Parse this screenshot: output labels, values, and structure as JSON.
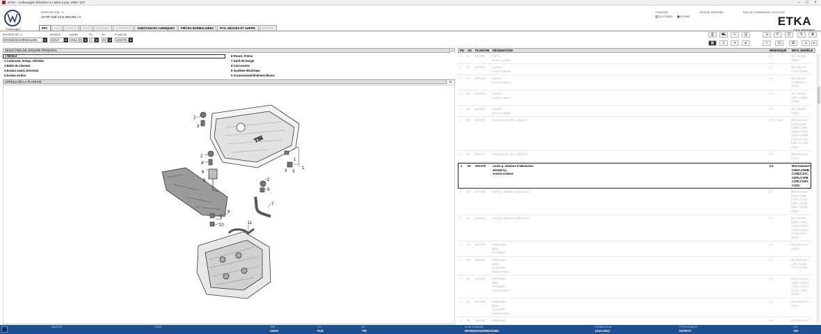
{
  "window": {
    "title": "ETKA - Volkswagen Révision 8.1 Mise à jour 1380 / 227"
  },
  "header": {
    "brand_label": "Volkswagen",
    "proposition_label": "PROPOSITION / 3",
    "proposition_value": "ACTIF  Golf A3 E 000 001 >>",
    "mode_label": "ÉTENDUE",
    "mode_options": [
      "ALLOWED",
      "ETHNIC"
    ],
    "link1": "BON DE MATÉRIEL",
    "link2": "BON DE COMMANDE COLLECTIF",
    "etka_logo": "ETKA",
    "etka_sub": "Parts Information"
  },
  "tabs": [
    {
      "label": "EPC",
      "state": "active"
    },
    {
      "label": "ACC",
      "state": "disabled"
    },
    {
      "label": "TOOLS",
      "state": "disabled"
    },
    {
      "label": "ROW",
      "state": "disabled"
    },
    {
      "label": "WEOLDIE",
      "state": "disabled"
    },
    {
      "label": "AUTOPART",
      "state": "disabled"
    },
    {
      "label": "SUBSTANCES CHIMIQUES",
      "state": "normal"
    },
    {
      "label": "PIÈCES NORMALISÉES",
      "state": "normal"
    },
    {
      "label": "PCS. NEUVES ET SUPPR.",
      "state": "normal"
    },
    {
      "label": "REPORT",
      "state": "disabled"
    }
  ],
  "search": {
    "recherche_label": "RECHERCHE / II",
    "recherche_value": "WVWZZZAUZEW211496",
    "modele_label": "MODÈLE",
    "modele_value": "GOLF",
    "annee_label": "ANNÉE",
    "annee_value": "2014 (E)",
    "pg_label": "PG",
    "pg_value": "1",
    "sg_label": "SG",
    "sg_value": "03",
    "planche_label": "PLANCHE",
    "planche_value": "103-075"
  },
  "group_panel": {
    "title": "SÉLECTION DE GROUPE PRINCIPAL",
    "items": [
      {
        "label": "1   Moteur",
        "selected": true
      },
      {
        "label": "2   Carburant, échap. refroidis."
      },
      {
        "label": "3   Boîte de vitesses"
      },
      {
        "label": "4   Essieu avant, Direction"
      },
      {
        "label": "5   Essieu arrière"
      },
      {
        "label": "6   Roues, Freins"
      },
      {
        "label": "7   Outil de levage"
      },
      {
        "label": "8   Carrosserie"
      },
      {
        "label": "9   Système électrique"
      },
      {
        "label": "0   Accessoires/Infodivert./divers"
      }
    ]
  },
  "apercu": {
    "title": "APERÇU DE LA PLANCHE",
    "callouts": [
      "1",
      "1",
      "2",
      "2",
      "2",
      "3",
      "3",
      "3",
      "3",
      "4",
      "5",
      "6",
      "7",
      "8",
      "9",
      "10",
      "11"
    ]
  },
  "parts_table": {
    "headers": [
      "PG",
      "SG",
      "PLANCHE",
      "DÉSIGNATION",
      "REMARQUE",
      "INFO. MODÈLE"
    ],
    "rows": [
      {
        "pg": "1",
        "sg": "03",
        "planche": "103-055",
        "designation": "Cache\ncouvre-culasse",
        "remarque": "1,0",
        "info": "Mot. diesel+\nDBHA",
        "selected": false
      },
      {
        "pg": "1",
        "sg": "03",
        "planche": "103-060",
        "designation": "Culasse\ncouvre-culasse",
        "remarque": "2,0",
        "info": "Mot. diesel+\nCHHA,CRBC",
        "selected": false
      },
      {
        "pg": "1",
        "sg": "03",
        "planche": "103-062",
        "designation": "Culasse\ncouvre-culasse",
        "remarque": "2,0",
        "info": "Mot. diesel+\nCYKB,DEJA,\nDEJB",
        "selected": false
      },
      {
        "pg": "1",
        "sg": "03",
        "planche": "103-065",
        "designation": "Culasse\ncouvre-culasse",
        "remarque": "2,0",
        "info": "Mot. diesel+\nCRLB,CRMC,\nCRMA",
        "selected": false
      },
      {
        "pg": "1",
        "sg": "03",
        "planche": "103-067",
        "designation": "Culasse\ncouvre-culasse",
        "remarque": "2,0",
        "info": "Mot. diesel+\nCRQA",
        "selected": false
      },
      {
        "pg": "1",
        "sg": "03",
        "planche": "103-070",
        "designation": "Aération pour bloc-cylindres",
        "remarque": "1,0-1,4 litre",
        "info": "Mot.essence+\nCJZA,CJZB,\nCMBA,CHPA,\nCPWA,CPTA,\nCXSA,CPWB,\nCYVA,CYVB,\nCZEA,CPWB,\nCZCA",
        "selected": false
      },
      {
        "pg": "1",
        "sg": "03",
        "planche": "103-072",
        "designation": "Aération pour bloc-cylindres",
        "remarque": "1,8",
        "info": "Mot.essence+\nCJSA",
        "selected": false
      },
      {
        "pg": "1",
        "sg": "03",
        "planche": "103-075",
        "designation": "cache p. tubulure d'admission\naération p.\ncouvre-culasse",
        "remarque": "2,0",
        "info": "Mot.essence+\nCHHA,CHHB,\nCJXB,CJXC,\nCNTA,CYFB,\nCJXE,CXDA,\nCJXG",
        "selected": true
      },
      {
        "pg": "1",
        "sg": "03",
        "planche": "103-080",
        "designation": "cache p. tubulure d'admission",
        "remarque": "1,0",
        "info": "Mot.essence+\nCJZA,CJZB,\nCYVA,CYVB,\nCHPA,CXSB,\nDBKA,CXSB,\nDBKA",
        "selected": false
      },
      {
        "pg": "1",
        "sg": "03",
        "planche": "103-090",
        "designation": "cache p. tubulure d'admission",
        "remarque": "2,0",
        "info": "Mot. diesel+\nCRBC,CRKA,\nCRLB,CRMC,\nCRLC,CRMA,\nCYKB,DEJA,\nDEJB",
        "selected": false
      },
      {
        "pg": "1",
        "sg": "03",
        "planche": "105-005",
        "designation": "Vilebrequin\nbielle\ncoussinets",
        "remarque": "1,0",
        "info": "Mot.essence+\nCHZD",
        "selected": false
      },
      {
        "pg": "1",
        "sg": "05",
        "planche": "105-051",
        "designation": "Vilebrequin\nbielle\ncoussinets\nsolant moteur",
        "remarque": "1,2",
        "info": "Mot.essence+\nCJZA,CJZB,\nCYVA,CYVB",
        "selected": false
      },
      {
        "pg": "1",
        "sg": "05",
        "planche": "105-053",
        "designation": "Vilebrequin\nbielle\ncoussinets\nsolant moteur",
        "remarque": "1,4",
        "info": "Mot.essence+\nCMBA,CPWA,\nCPWA,CXSA,\nCZCA,CZDA,\nCPVB",
        "selected": false
      },
      {
        "pg": "1",
        "sg": "05",
        "planche": "105-055",
        "designation": "Vilebrequin\nbielle\ncoussinets\nsolant moteur",
        "remarque": "1,4",
        "info": "Mot.essence+\nCPVA",
        "selected": false
      },
      {
        "pg": "1",
        "sg": "05",
        "planche": "105-060",
        "designation": "Vilebrequin\nbielle\ncoussinets",
        "remarque": "1,8",
        "info": "Mot.essence+\nCJSA",
        "selected": false
      }
    ]
  },
  "statusbar": {
    "fields": [
      {
        "label": "MARCHÉ",
        "value": ""
      },
      {
        "label": "CODE",
        "value": ""
      },
      {
        "label": "CRE",
        "value": "CHHA"
      },
      {
        "label": "LFC",
        "value": "PUS"
      },
      {
        "label": "BC",
        "value": "TW"
      },
      {
        "label": "Nº DE CHÂSSIS",
        "value": "WVWZZZAUZEW211496"
      },
      {
        "label": "PRODUCTION",
        "value": "13.01.2014"
      },
      {
        "label": "TYPE DE BOÎTE",
        "value": "SUTEOY"
      },
      {
        "label": "LFP",
        "value": "740"
      }
    ]
  },
  "colors": {
    "status_bar": "#1d4f91",
    "panel_header": "#dedede",
    "disabled_text": "#b6b6b6"
  }
}
